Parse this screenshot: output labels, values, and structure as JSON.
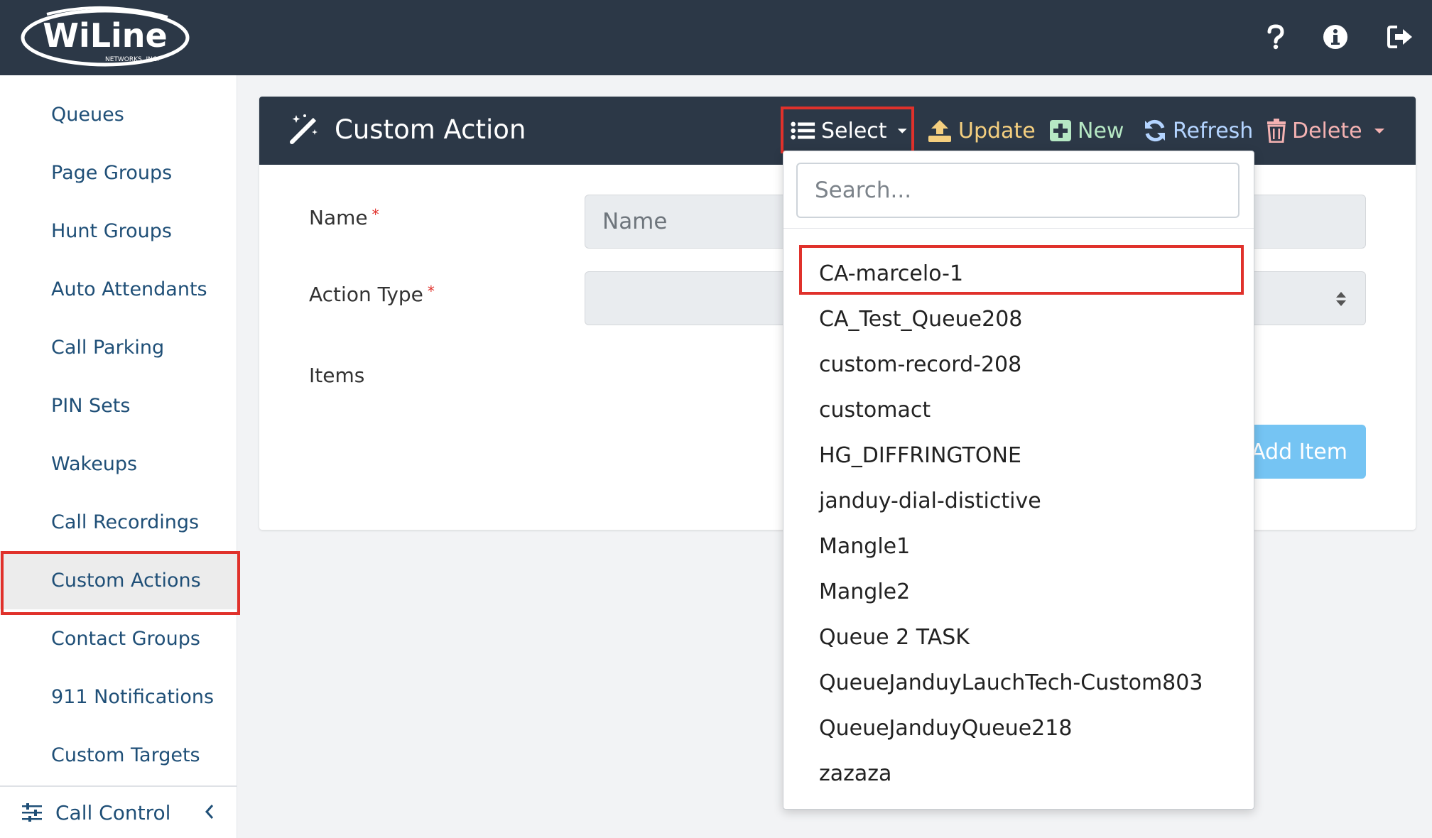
{
  "brand": {
    "logo_word": "WiLine",
    "logo_tagline": "NETWORKS, INC."
  },
  "topbar": {
    "help_icon": "question-icon",
    "info_icon": "info-circle-icon",
    "logout_icon": "sign-out-icon"
  },
  "sidebar": {
    "items": [
      {
        "label": "Queues"
      },
      {
        "label": "Page Groups"
      },
      {
        "label": "Hunt Groups"
      },
      {
        "label": "Auto Attendants"
      },
      {
        "label": "Call Parking"
      },
      {
        "label": "PIN Sets"
      },
      {
        "label": "Wakeups"
      },
      {
        "label": "Call Recordings"
      },
      {
        "label": "Custom Actions",
        "active": true
      },
      {
        "label": "Contact Groups"
      },
      {
        "label": "911 Notifications"
      },
      {
        "label": "Custom Targets"
      }
    ],
    "footer": {
      "label": "Call Control"
    }
  },
  "card": {
    "title": "Custom Action",
    "toolbar": {
      "select": "Select",
      "update": "Update",
      "new": "New",
      "refresh": "Refresh",
      "delete": "Delete"
    },
    "form": {
      "name_label": "Name",
      "name_placeholder": "Name",
      "type_label": "Action Type",
      "items_label": "Items",
      "required_mark": "*",
      "add_item": "Add Item"
    }
  },
  "dropdown": {
    "search_placeholder": "Search...",
    "items": [
      "CA-marcelo-1",
      "CA_Test_Queue208",
      "custom-record-208",
      "customact",
      "HG_DIFFRINGTONE",
      "janduy-dial-distictive",
      "Mangle1",
      "Mangle2",
      "Queue 2 TASK",
      "QueueJanduyLauchTech-Custom803",
      "QueueJanduyQueue218",
      "zazaza"
    ],
    "highlighted": "CA-marcelo-1"
  },
  "colors": {
    "header_bg": "#2c3847",
    "link": "#1f4f77",
    "highlight_border": "#e0312b",
    "update": "#f5cf7f",
    "new": "#b6e8c4",
    "refresh": "#b4d4ff",
    "delete": "#f4b2b2",
    "add_button": "#75c4f3"
  }
}
